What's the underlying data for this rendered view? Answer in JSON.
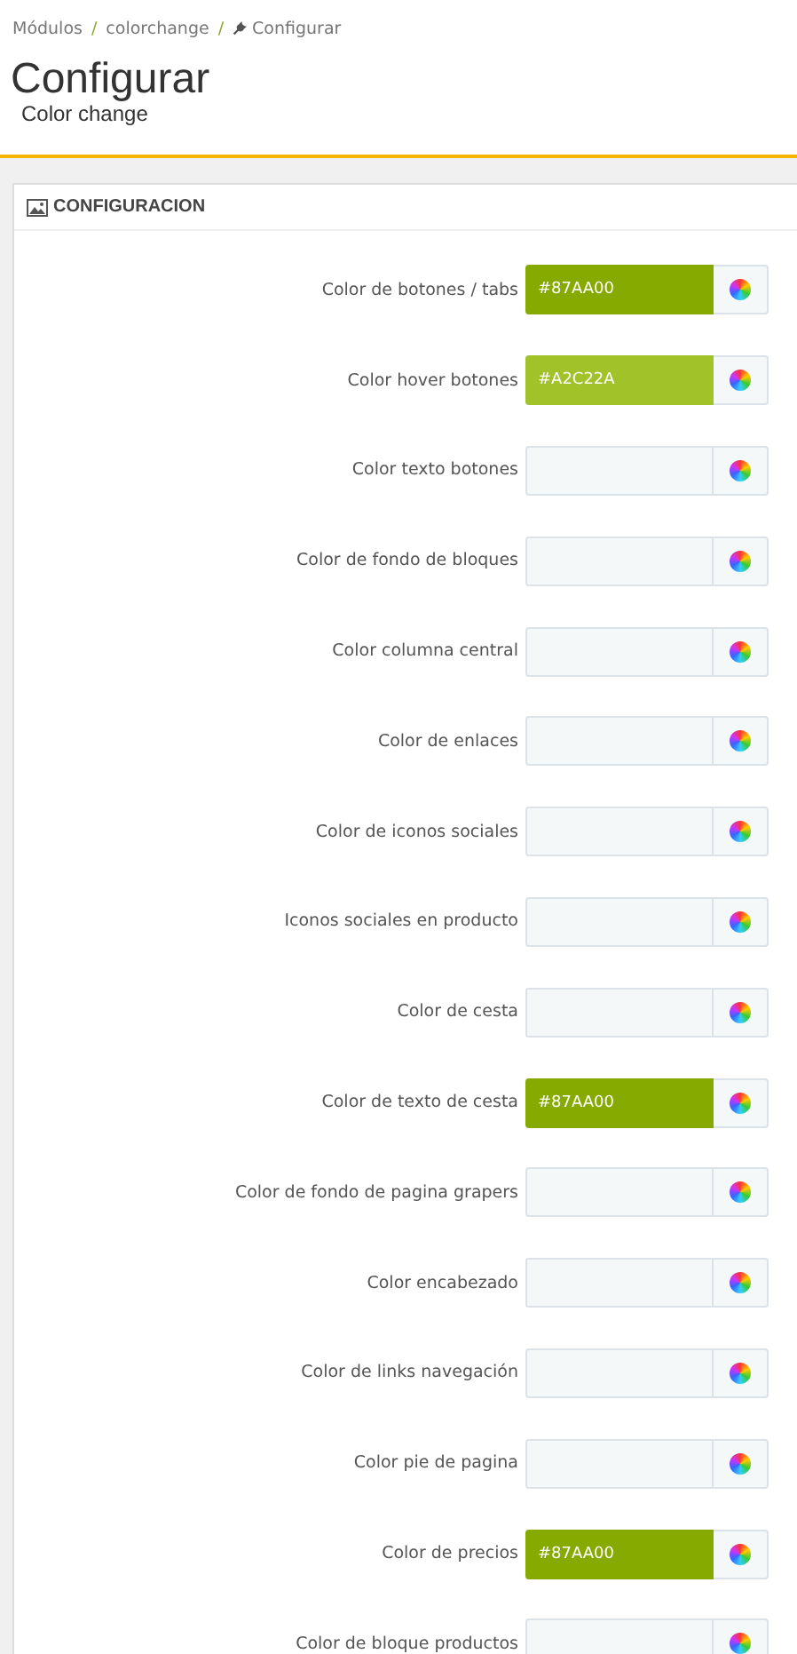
{
  "breadcrumb": [
    "Módulos",
    "colorchange",
    "Configurar"
  ],
  "breadcrumb_separator": "/",
  "title": "Configurar",
  "subtitle": "Color change",
  "panel": {
    "heading": "CONFIGURACION"
  },
  "fields": [
    {
      "label": "Color de botones / tabs",
      "value": "#87AA00",
      "color": "#87aa00"
    },
    {
      "label": "Color hover botones",
      "value": "#A2C22A",
      "color": "#a2c22a"
    },
    {
      "label": "Color texto botones"
    },
    {
      "label": "Color de fondo de bloques"
    },
    {
      "label": "Color columna central"
    },
    {
      "label": "Color de enlaces"
    },
    {
      "label": "Color de iconos sociales"
    },
    {
      "label": "Iconos sociales en producto"
    },
    {
      "label": "Color de cesta"
    },
    {
      "label": "Color de texto de cesta",
      "value": "#87AA00",
      "color": "#87aa00"
    },
    {
      "label": "Color de fondo de pagina grapers"
    },
    {
      "label": "Color encabezado"
    },
    {
      "label": "Color de links navegación"
    },
    {
      "label": "Color pie de pagina"
    },
    {
      "label": "Color de precios",
      "value": "#87AA00",
      "color": "#87aa00"
    },
    {
      "label": "Color de bloque productos"
    }
  ]
}
